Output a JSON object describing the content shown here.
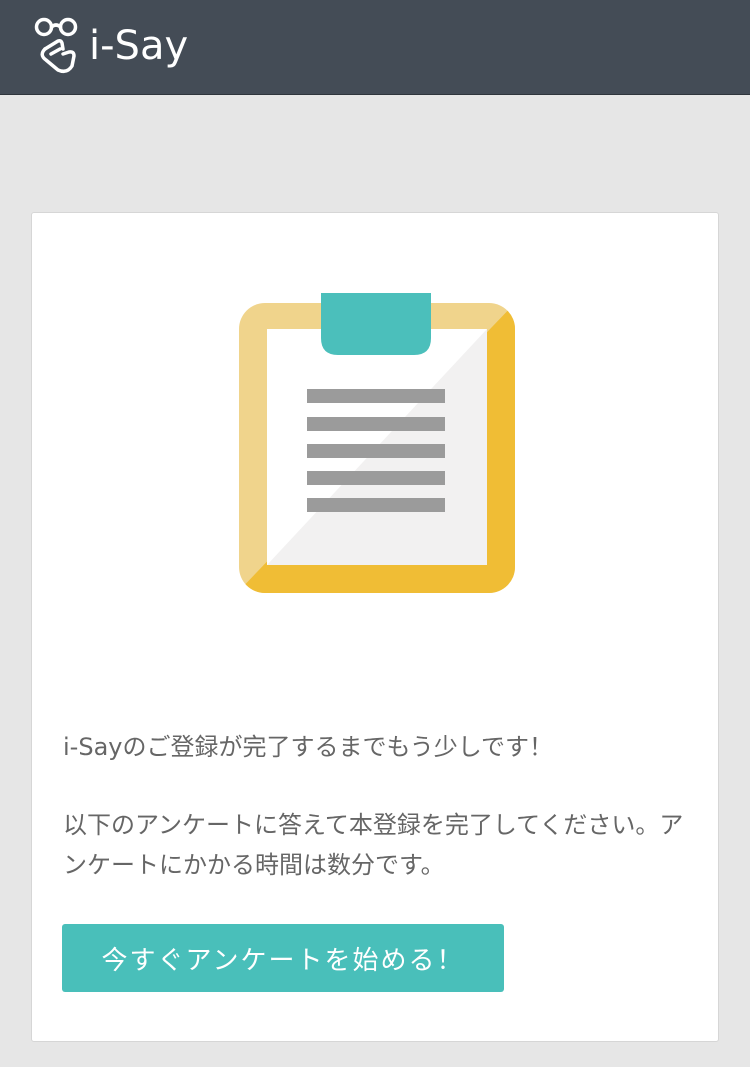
{
  "header": {
    "brand": "i-Say",
    "logo_icon": "glasses-hand-icon",
    "background": "#444c56"
  },
  "card": {
    "illustration_icon": "clipboard-icon",
    "message_1": "i-Sayのご登録が完了するまでもう少しです！",
    "message_2": "以下のアンケートに答えて本登録を完了してください。アンケートにかかる時間は数分です。",
    "start_button_label": "今すぐアンケートを始める！"
  },
  "colors": {
    "accent": "#49bfba",
    "clipboard_frame": "#f0bd35",
    "page_background": "#e6e6e6"
  }
}
